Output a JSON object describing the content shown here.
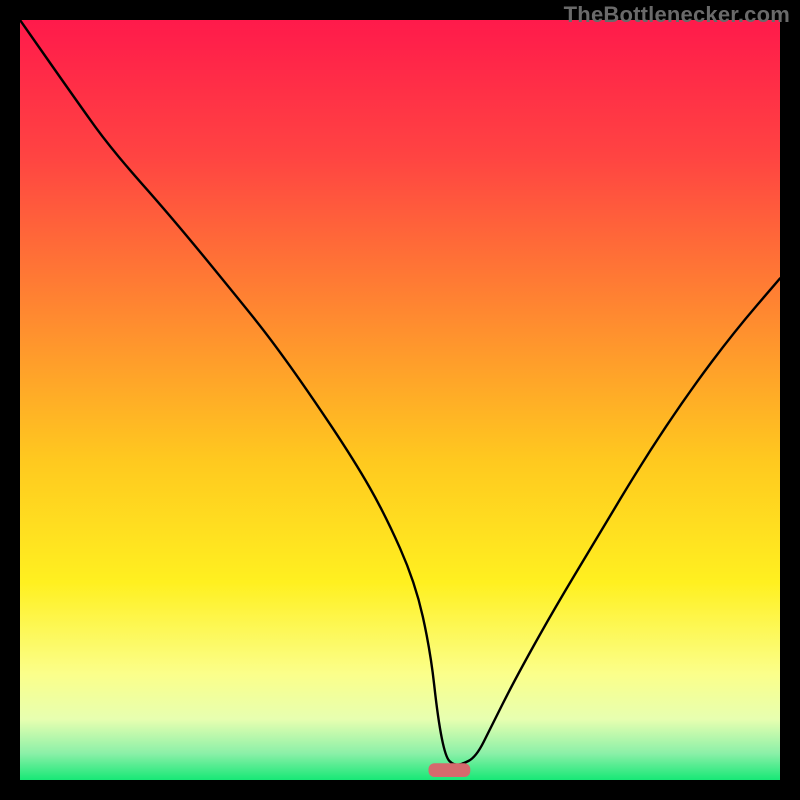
{
  "watermark": "TheBottlenecker.com",
  "chart_data": {
    "type": "line",
    "title": "",
    "xlabel": "",
    "ylabel": "",
    "xlim": [
      0,
      100
    ],
    "ylim": [
      0,
      100
    ],
    "series": [
      {
        "name": "bottleneck-curve",
        "x": [
          0,
          7,
          12,
          20,
          29,
          33,
          38,
          44,
          48,
          52,
          54,
          55,
          56,
          57,
          58,
          60,
          62,
          65,
          70,
          76,
          82,
          88,
          94,
          100
        ],
        "values": [
          100,
          90,
          83,
          74,
          63,
          58,
          51,
          42,
          35,
          26,
          17,
          8,
          3,
          2,
          2,
          3,
          7,
          13,
          22,
          32,
          42,
          51,
          59,
          66
        ]
      }
    ],
    "marker": {
      "name": "target-marker",
      "x": 56.5,
      "y": 1.3,
      "width": 5.5,
      "height": 1.8,
      "color": "#d56a6d"
    },
    "gradient_stops": [
      {
        "offset": 0.0,
        "color": "#ff1a4b"
      },
      {
        "offset": 0.18,
        "color": "#ff4442"
      },
      {
        "offset": 0.4,
        "color": "#ff8d2f"
      },
      {
        "offset": 0.58,
        "color": "#ffc91f"
      },
      {
        "offset": 0.74,
        "color": "#fff020"
      },
      {
        "offset": 0.86,
        "color": "#fbff8a"
      },
      {
        "offset": 0.92,
        "color": "#e7ffb0"
      },
      {
        "offset": 0.965,
        "color": "#8bf0a8"
      },
      {
        "offset": 1.0,
        "color": "#17e876"
      }
    ]
  }
}
